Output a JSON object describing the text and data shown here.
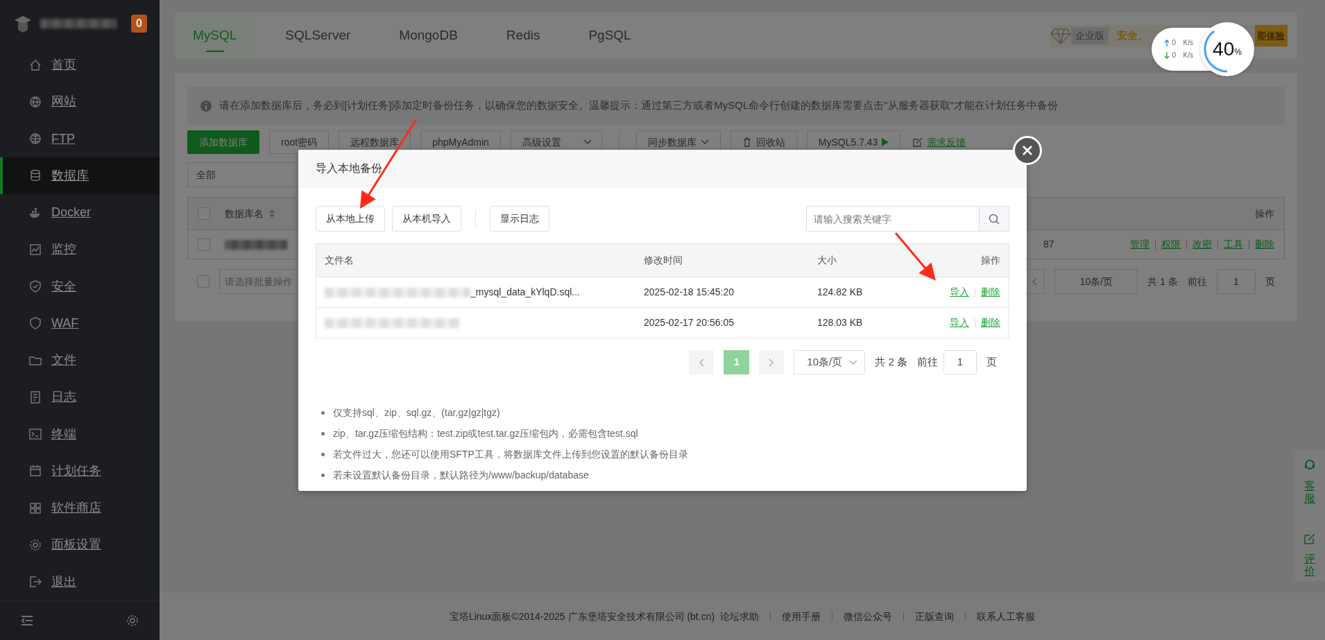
{
  "sidebar": {
    "badge": "0",
    "items": [
      {
        "label": "首页",
        "selected": false
      },
      {
        "label": "网站",
        "selected": false
      },
      {
        "label": "FTP",
        "selected": false
      },
      {
        "label": "数据库",
        "selected": true
      },
      {
        "label": "Docker",
        "selected": false
      },
      {
        "label": "监控",
        "selected": false
      },
      {
        "label": "安全",
        "selected": false
      },
      {
        "label": "WAF",
        "selected": false
      },
      {
        "label": "文件",
        "selected": false
      },
      {
        "label": "日志",
        "selected": false
      },
      {
        "label": "终端",
        "selected": false
      },
      {
        "label": "计划任务",
        "selected": false
      },
      {
        "label": "软件商店",
        "selected": false
      },
      {
        "label": "面板设置",
        "selected": false
      },
      {
        "label": "退出",
        "selected": false
      }
    ]
  },
  "db_tabs": [
    {
      "label": "MySQL",
      "selected": true
    },
    {
      "label": "SQLServer",
      "selected": false
    },
    {
      "label": "MongoDB",
      "selected": false
    },
    {
      "label": "Redis",
      "selected": false
    },
    {
      "label": "PgSQL",
      "selected": false
    }
  ],
  "promo": {
    "edition": "企业版",
    "slogan": "安全、",
    "cta": "即体验"
  },
  "speed_widget": {
    "upload": "0",
    "download": "0",
    "upload_unit": "K/s",
    "download_unit": "K/s",
    "percent": "40",
    "percent_sign": "%",
    "level": 0.4
  },
  "notice": {
    "before": "请在添加数据库后，务必到",
    "link": "[计划任务]",
    "after": "添加定时备份任务，以确保您的数据安全。温馨提示：通过第三方或者MySQL命令行创建的数据库需要点击\"从服务器获取\"才能在计划任务中备份"
  },
  "toolbar": [
    {
      "kind": "primary",
      "label": "添加数据库"
    },
    {
      "kind": "default",
      "label": "root密码"
    },
    {
      "kind": "default",
      "label": "远程数据库"
    },
    {
      "kind": "default",
      "label": "phpMyAdmin"
    },
    {
      "kind": "split",
      "label": "高级设置"
    },
    {
      "kind": "divider"
    },
    {
      "kind": "dropdown",
      "label": "同步数据库"
    },
    {
      "kind": "trash",
      "label": "回收站"
    },
    {
      "kind": "version",
      "label": "MySQL5.7.43"
    },
    {
      "kind": "link",
      "label": "需求反馈"
    }
  ],
  "filter": {
    "value": "全部"
  },
  "db_table": {
    "header_checked": false,
    "footer_checked": false,
    "columns": [
      "数据库名",
      "操作"
    ],
    "rows": [
      {
        "checked": false,
        "cell": "87",
        "actions": [
          "管理",
          "权限",
          "改密",
          "工具",
          "删除"
        ]
      }
    ],
    "bulk_placeholder": "请选择批量操作",
    "pagination": {
      "page_size": "10条/页",
      "total": "共 1 条",
      "goto": "前往",
      "page": "1",
      "suffix": "页"
    }
  },
  "modal": {
    "title": "导入本地备份",
    "buttons": [
      "从本地上传",
      "从本机导入",
      "显示日志"
    ],
    "search": {
      "placeholder": "请输入搜索关键字"
    },
    "columns": [
      "文件名",
      "修改时间",
      "大小",
      "操作"
    ],
    "rows": [
      {
        "file": "_mysql_data_kYlqD.sql...",
        "time": "2025-02-18 15:45:20",
        "size": "124.82 KB",
        "actions": [
          "导入",
          "删除"
        ]
      },
      {
        "file": "",
        "time": "2025-02-17 20:56:05",
        "size": "128.03 KB",
        "actions": [
          "导入",
          "删除"
        ]
      }
    ],
    "pagination": {
      "pages": [
        {
          "label": "1",
          "selected": true
        }
      ],
      "page_size": "10条/页",
      "total": "共 2 条",
      "goto": "前往",
      "page": "1",
      "suffix": "页"
    },
    "notes": [
      "仅支持sql、zip、sql.gz、(tar.gz|gz|tgz)",
      "zip、tar.gz压缩包结构：test.zip或test.tar.gz压缩包内，必需包含test.sql",
      "若文件过大，您还可以使用SFTP工具，将数据库文件上传到您设置的默认备份目录",
      "若未设置默认备份目录，默认路径为/www/backup/database"
    ]
  },
  "float_panel": [
    "客服",
    "评价"
  ],
  "footer": {
    "copyright": "宝塔Linux面板©2014-2025 广东堡塔安全技术有限公司 (bt.cn)",
    "links": [
      "论坛求助",
      "使用手册",
      "微信公众号",
      "正版查询",
      "联系人工客服"
    ]
  }
}
